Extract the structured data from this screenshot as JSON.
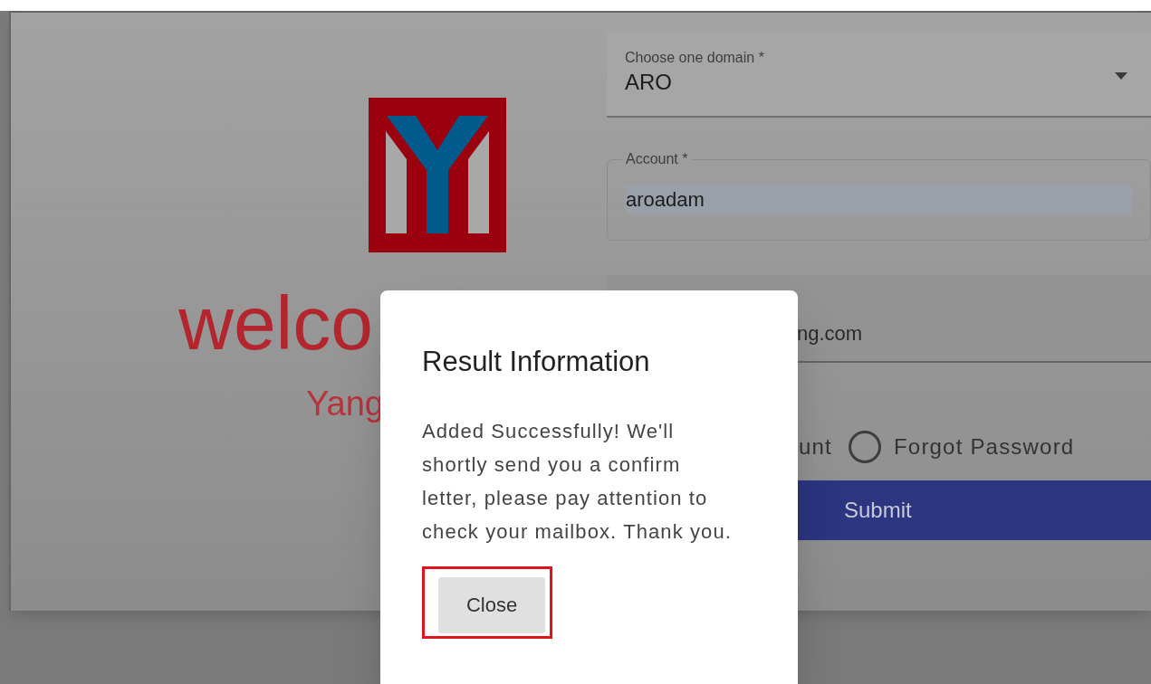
{
  "background": {
    "welcome": "welco",
    "subtitle": "Yang"
  },
  "form": {
    "domain": {
      "label": "Choose one domain *",
      "value": "ARO"
    },
    "account": {
      "label": "Account *",
      "value": "aroadam",
      "autofilled": true
    },
    "email": {
      "value": "ng.com"
    },
    "radio_tail": "unt",
    "radio": {
      "label": "Forgot Password",
      "selected": false
    },
    "submit": "Submit"
  },
  "dialog": {
    "title": "Result Information",
    "message": "Added Successfully! We'll shortly send you a confirm letter, please pay attention to check your mailbox. Thank you.",
    "button": "Close",
    "highlighted": true
  }
}
